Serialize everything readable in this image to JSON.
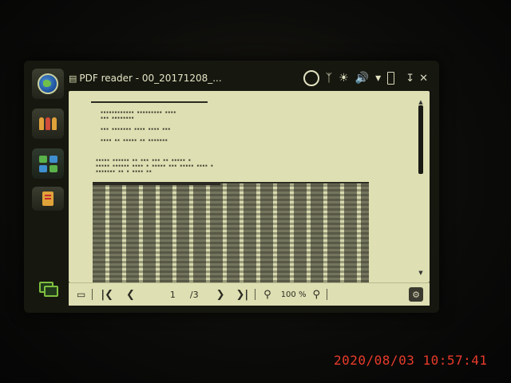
{
  "window": {
    "title": "PDF reader - 00_20171208_..."
  },
  "status_icons": [
    "ring-icon",
    "bluetooth-icon",
    "brightness-icon",
    "volume-icon",
    "wifi-icon",
    "battery-icon"
  ],
  "window_buttons": [
    "minimize-icon",
    "close-icon"
  ],
  "sidebar": {
    "items": [
      {
        "icon": "globe-icon"
      },
      {
        "icon": "people-icon"
      },
      {
        "icon": "apps-grid-icon"
      },
      {
        "icon": "document-app-icon"
      },
      {
        "icon": "windows-icon"
      }
    ]
  },
  "toolbar": {
    "page_current": "1",
    "page_total": "/3",
    "zoom_level": "100 %"
  },
  "camera": {
    "timestamp": "2020/08/03  10:57:41"
  },
  "colors": {
    "page_background": "#dedfb2",
    "timestamp": "#e83b2b",
    "apps_accent": "#7fbf3f"
  }
}
